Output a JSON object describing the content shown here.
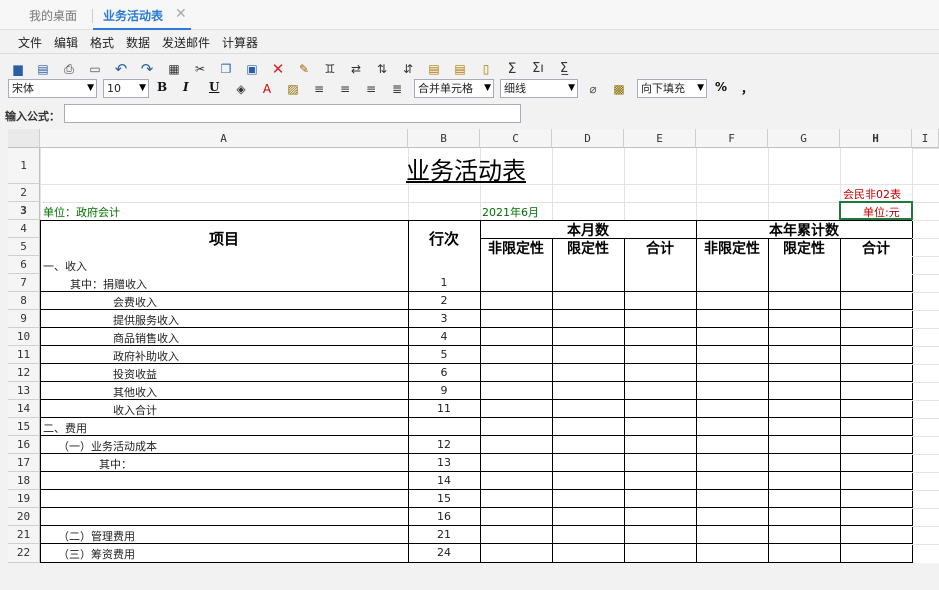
{
  "tabs": {
    "home": "我的桌面",
    "active": "业务活动表",
    "close_glyph": "✕"
  },
  "menu": [
    "文件",
    "编辑",
    "格式",
    "数据",
    "发送邮件",
    "计算器"
  ],
  "toolbar": {
    "font_family": "宋体",
    "font_size": "10",
    "bold": "B",
    "italic": "I",
    "underline": "U",
    "merge_cells": "合并单元格",
    "border_style": "细线",
    "fill_down": "向下填充",
    "percent": "%",
    "comma": "，",
    "icons": [
      "save-icon",
      "save-as-icon",
      "print-preview-icon",
      "print-icon",
      "undo-icon",
      "redo-icon",
      "grid-icon",
      "cut-icon",
      "copy-icon",
      "paste-icon",
      "delete-icon",
      "brush-icon",
      "find-icon",
      "replace-icon",
      "sort-asc-icon",
      "sort-desc-icon",
      "paste-special-icon",
      "paste-values-icon",
      "page-icon",
      "sum-icon",
      "sum-row-icon",
      "sum-col-icon"
    ]
  },
  "formula_bar": {
    "label": "输入公式：",
    "value": ""
  },
  "sheet": {
    "columns": [
      "A",
      "B",
      "C",
      "D",
      "E",
      "F",
      "G",
      "H",
      "I"
    ],
    "rows": [
      "1",
      "2",
      "3",
      "4",
      "5",
      "6",
      "7",
      "8",
      "9",
      "10",
      "11",
      "12",
      "13",
      "14",
      "15",
      "16",
      "17",
      "18",
      "19",
      "20",
      "21",
      "22"
    ],
    "title": "业务活动表",
    "form_code": "会民非02表",
    "unit_org": "单位：政府会计",
    "period": "2021年6月",
    "unit_currency": "单位:元",
    "header": {
      "item": "项目",
      "line": "行次",
      "this_month": "本月数",
      "ytd": "本年累计数",
      "unrestricted": "非限定性",
      "restricted": "限定性",
      "total": "合计"
    },
    "items": [
      {
        "label": "一、收入",
        "line": ""
      },
      {
        "label": "其中：捐赠收入",
        "line": "1"
      },
      {
        "label": "会费收入",
        "line": "2"
      },
      {
        "label": "提供服务收入",
        "line": "3"
      },
      {
        "label": "商品销售收入",
        "line": "4"
      },
      {
        "label": "政府补助收入",
        "line": "5"
      },
      {
        "label": "投资收益",
        "line": "6"
      },
      {
        "label": "其他收入",
        "line": "9"
      },
      {
        "label": "收入合计",
        "line": "11"
      },
      {
        "label": "二、费用",
        "line": ""
      },
      {
        "label": "（一）业务活动成本",
        "line": "12"
      },
      {
        "label": "其中：",
        "line": "13"
      },
      {
        "label": "",
        "line": "14"
      },
      {
        "label": "",
        "line": "15"
      },
      {
        "label": "",
        "line": "16"
      },
      {
        "label": "（二）管理费用",
        "line": "21"
      },
      {
        "label": "（三）筹资费用",
        "line": "24"
      }
    ]
  }
}
